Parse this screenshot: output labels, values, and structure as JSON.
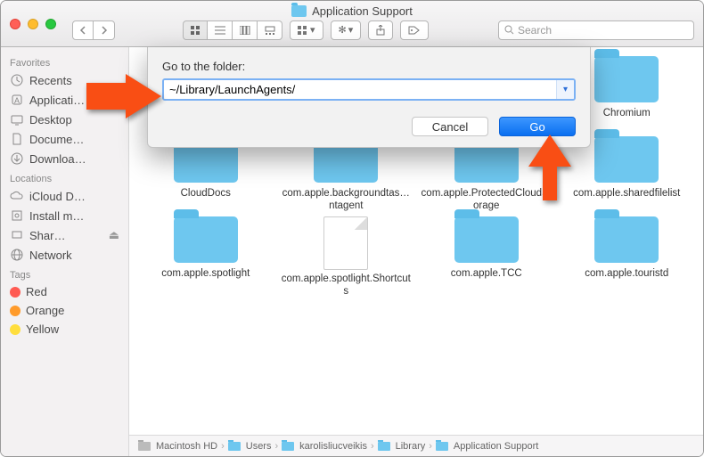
{
  "window": {
    "title": "Application Support"
  },
  "search": {
    "placeholder": "Search"
  },
  "sidebar": {
    "sections": [
      {
        "title": "Favorites",
        "items": [
          {
            "label": "Recents",
            "icon": "clock"
          },
          {
            "label": "Applicati…",
            "icon": "app"
          },
          {
            "label": "Desktop",
            "icon": "desktop"
          },
          {
            "label": "Docume…",
            "icon": "doc"
          },
          {
            "label": "Downloa…",
            "icon": "download"
          }
        ]
      },
      {
        "title": "Locations",
        "items": [
          {
            "label": "iCloud D…",
            "icon": "cloud"
          },
          {
            "label": "Install m…",
            "icon": "disk"
          },
          {
            "label": "Shar…",
            "icon": "network",
            "eject": true
          },
          {
            "label": "Network",
            "icon": "globe"
          }
        ]
      },
      {
        "title": "Tags",
        "items": [
          {
            "label": "Red",
            "color": "#ff5a52"
          },
          {
            "label": "Orange",
            "color": "#ff9b2b"
          },
          {
            "label": "Yellow",
            "color": "#ffde3d"
          }
        ]
      }
    ]
  },
  "dialog": {
    "label": "Go to the folder:",
    "value": "~/Library/LaunchAgents/",
    "cancel": "Cancel",
    "go": "Go"
  },
  "folders": [
    {
      "name": "",
      "type": "folder"
    },
    {
      "name": "",
      "type": "folder"
    },
    {
      "name": "",
      "type": "folder"
    },
    {
      "name": "Chromium",
      "type": "folder"
    },
    {
      "name": "CloudDocs",
      "type": "folder"
    },
    {
      "name": "com.apple.backgroundtas…ntagent",
      "type": "folder"
    },
    {
      "name": "com.apple.ProtectedCloudStorage",
      "type": "folder"
    },
    {
      "name": "com.apple.sharedfilelist",
      "type": "folder"
    },
    {
      "name": "com.apple.spotlight",
      "type": "folder"
    },
    {
      "name": "com.apple.spotlight.Shortcuts",
      "type": "file"
    },
    {
      "name": "com.apple.TCC",
      "type": "folder"
    },
    {
      "name": "com.apple.touristd",
      "type": "folder"
    }
  ],
  "path": [
    "Macintosh HD",
    "Users",
    "karolisliucveikis",
    "Library",
    "Application Support"
  ]
}
